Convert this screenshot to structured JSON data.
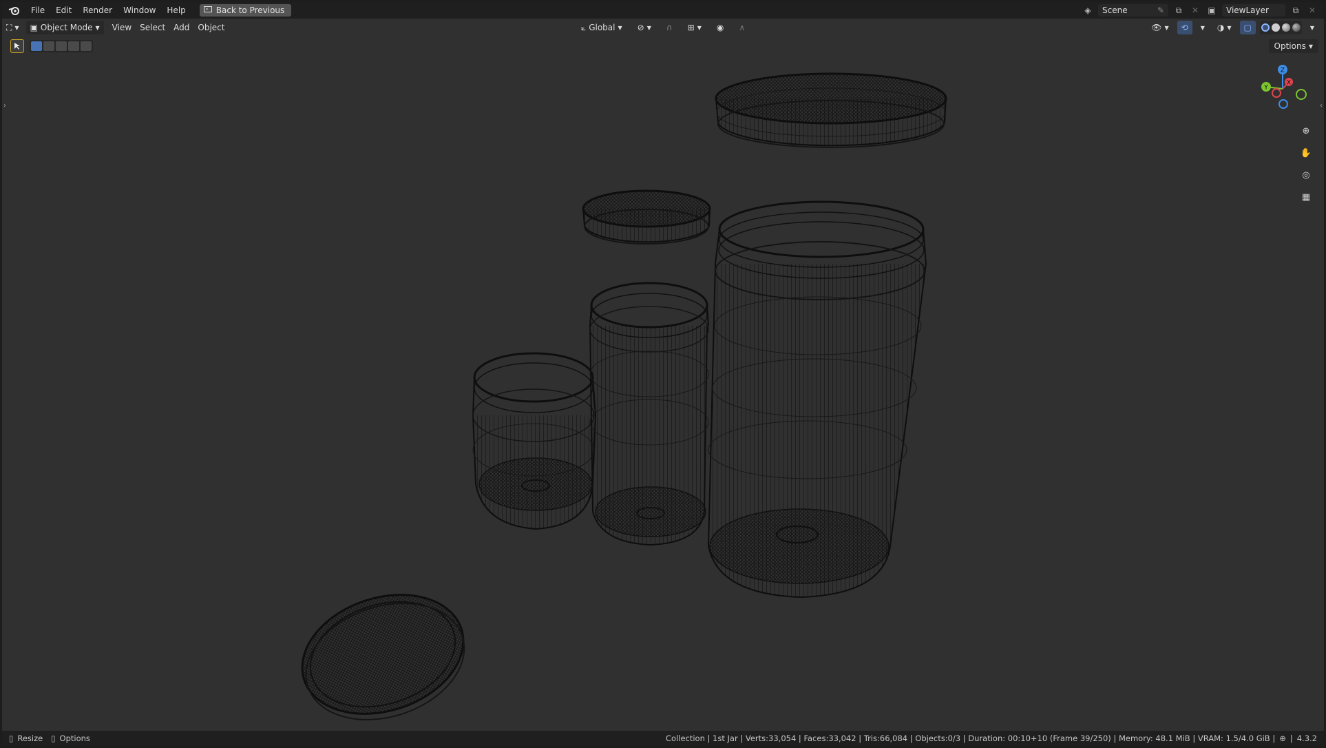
{
  "topbar": {
    "menu": [
      "File",
      "Edit",
      "Render",
      "Window",
      "Help"
    ],
    "back_button": "Back to Previous",
    "scene": "Scene",
    "view_layer": "ViewLayer"
  },
  "header": {
    "mode": "Object Mode",
    "menus": [
      "View",
      "Select",
      "Add",
      "Object"
    ],
    "orientation": "Global",
    "options": "Options"
  },
  "status": {
    "left_hint_1": "Resize",
    "left_hint_2": "Options",
    "info": "Collection | 1st Jar | Verts:33,054 | Faces:33,042 | Tris:66,084 | Objects:0/3 | Duration: 00:10+10 (Frame 39/250) | Memory: 48.1 MiB | VRAM: 1.5/4.0 GiB |",
    "version": "4.3.2"
  },
  "gizmo": {
    "x": "X",
    "y": "Y",
    "z": "Z"
  },
  "colors": {
    "background": "#303030",
    "wire": "#111111",
    "accent": "#4772b3",
    "x_axis": "#e0444e",
    "y_axis": "#7cc62e",
    "z_axis": "#3c8ee6"
  }
}
